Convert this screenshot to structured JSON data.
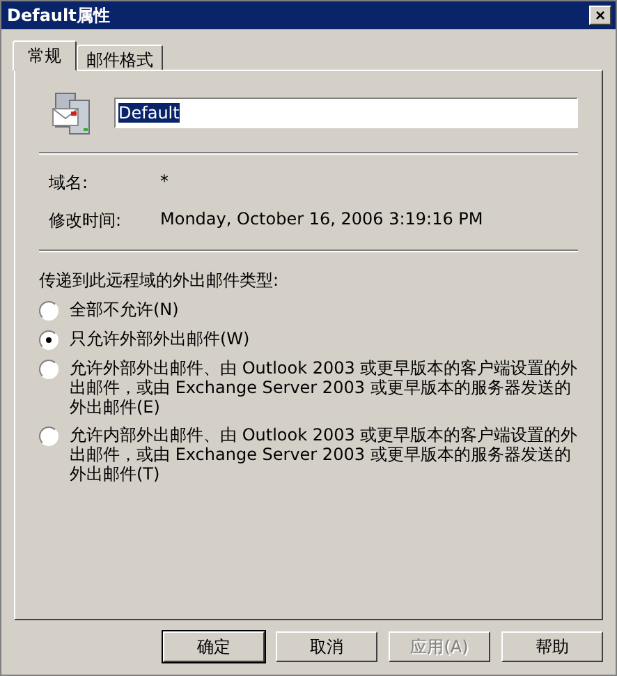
{
  "window": {
    "title": "Default属性",
    "close": "×"
  },
  "tabs": [
    {
      "label": "常规",
      "selected": true
    },
    {
      "label": "邮件格式",
      "selected": false
    }
  ],
  "name_field": {
    "value": "Default",
    "text_selected": true
  },
  "info": [
    {
      "label": "域名:",
      "value": "*"
    },
    {
      "label": "修改时间:",
      "value": "Monday, October 16, 2006 3:19:16 PM"
    }
  ],
  "delivery": {
    "heading": "传递到此远程域的外出邮件类型:",
    "options": [
      {
        "label": "全部不允许(N)",
        "selected": false
      },
      {
        "label": "只允许外部外出邮件(W)",
        "selected": true
      },
      {
        "label": "允许外部外出邮件、由 Outlook 2003 或更早版本的客户端设置的外出邮件，或由 Exchange Server 2003 或更早版本的服务器发送的外出邮件(E)",
        "selected": false
      },
      {
        "label": "允许内部外出邮件、由 Outlook 2003 或更早版本的客户端设置的外出邮件，或由 Exchange Server 2003 或更早版本的服务器发送的外出邮件(T)",
        "selected": false
      }
    ]
  },
  "buttons": [
    {
      "label": "确定",
      "default": true,
      "disabled": false
    },
    {
      "label": "取消",
      "default": false,
      "disabled": false
    },
    {
      "label": "应用(A)",
      "default": false,
      "disabled": true
    },
    {
      "label": "帮助",
      "default": false,
      "disabled": false
    }
  ]
}
